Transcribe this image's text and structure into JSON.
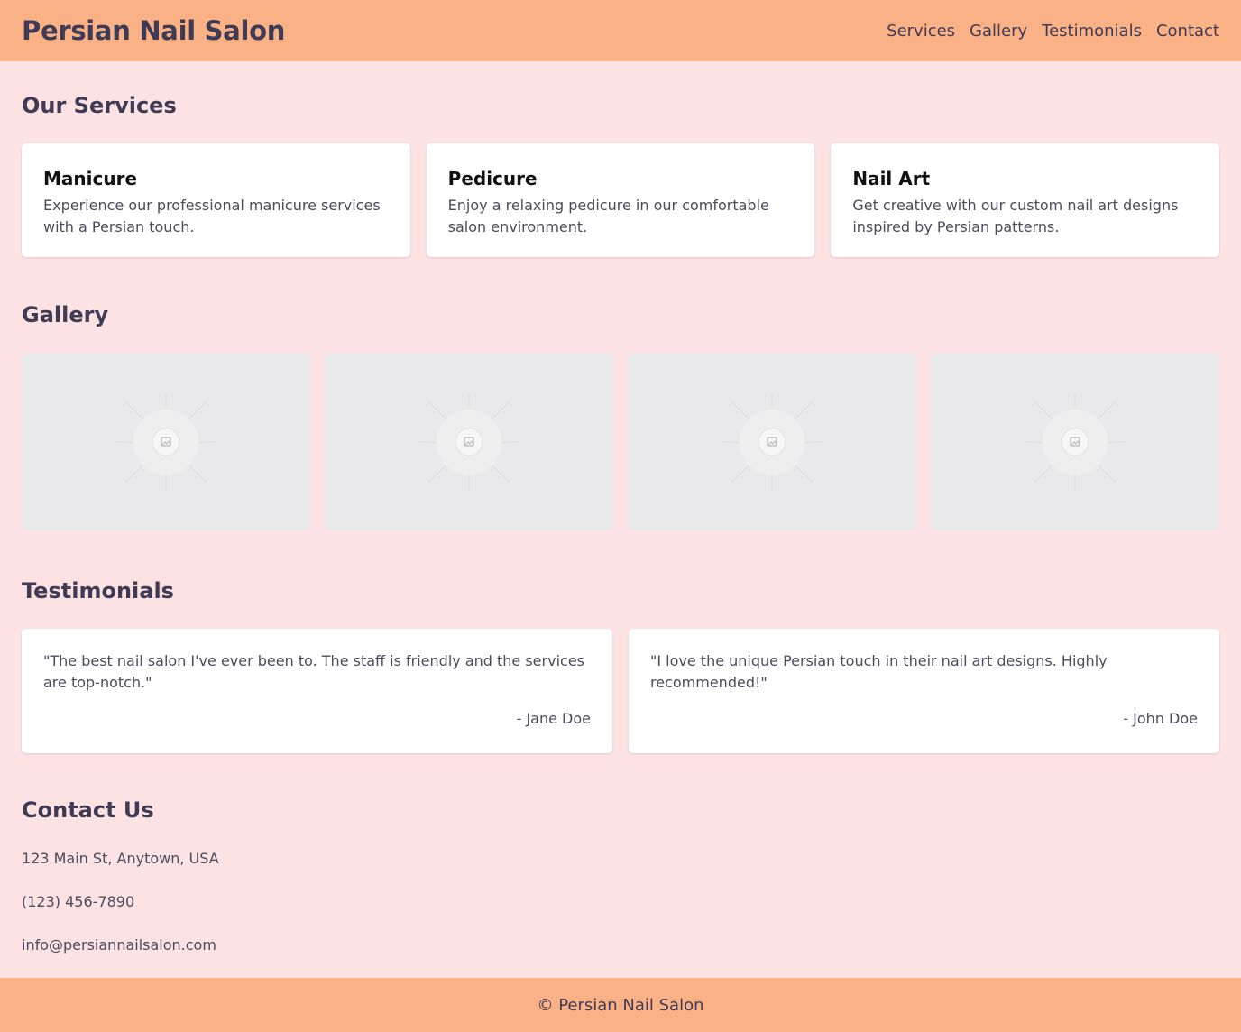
{
  "header": {
    "brand": "Persian Nail Salon",
    "nav": [
      "Services",
      "Gallery",
      "Testimonials",
      "Contact"
    ]
  },
  "services": {
    "title": "Our Services",
    "items": [
      {
        "name": "Manicure",
        "description": "Experience our professional manicure services with a Persian touch."
      },
      {
        "name": "Pedicure",
        "description": "Enjoy a relaxing pedicure in our comfortable salon environment."
      },
      {
        "name": "Nail Art",
        "description": "Get creative with our custom nail art designs inspired by Persian patterns."
      }
    ]
  },
  "gallery": {
    "title": "Gallery",
    "images": [
      "image-placeholder-icon",
      "image-placeholder-icon",
      "image-placeholder-icon",
      "image-placeholder-icon"
    ]
  },
  "testimonials": {
    "title": "Testimonials",
    "items": [
      {
        "quote": "\"The best nail salon I've ever been to. The staff is friendly and the services are top-notch.\"",
        "author": "- Jane Doe"
      },
      {
        "quote": "\"I love the unique Persian touch in their nail art designs. Highly recommended!\"",
        "author": "- John Doe"
      }
    ]
  },
  "contact": {
    "title": "Contact Us",
    "address": "123 Main St, Anytown, USA",
    "phone": "(123) 456-7890",
    "email": "info@persiannailsalon.com"
  },
  "footer": {
    "text": "© Persian Nail Salon"
  },
  "colors": {
    "header_bg": "#fbb186",
    "page_bg": "#fde2e4",
    "text": "#3f3b54",
    "card_bg": "#ffffff",
    "placeholder_bg": "#e9e8ea"
  }
}
